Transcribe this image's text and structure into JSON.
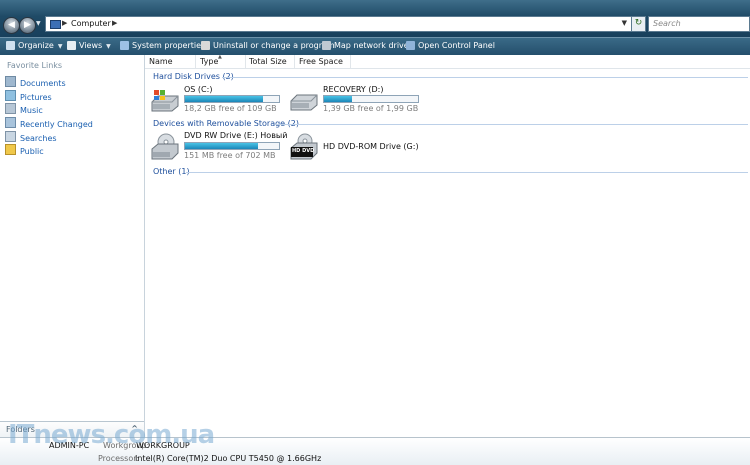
{
  "address_bar": {
    "path": [
      "Computer"
    ],
    "search_placeholder": "Search",
    "back_icon": "back-arrow-icon",
    "forward_icon": "forward-arrow-icon",
    "refresh_icon": "refresh-icon"
  },
  "toolbar": {
    "items": [
      {
        "label": "Organize",
        "icon": "organize-icon",
        "dropdown": true
      },
      {
        "label": "Views",
        "icon": "views-icon",
        "dropdown": true
      },
      {
        "label": "System properties",
        "icon": "system-properties-icon"
      },
      {
        "label": "Uninstall or change a program",
        "icon": "uninstall-icon"
      },
      {
        "label": "Map network drive",
        "icon": "network-drive-icon"
      },
      {
        "label": "Open Control Panel",
        "icon": "control-panel-icon"
      }
    ]
  },
  "nav_pane": {
    "title": "Favorite Links",
    "items": [
      {
        "label": "Documents",
        "icon": "documents-icon"
      },
      {
        "label": "Pictures",
        "icon": "pictures-icon"
      },
      {
        "label": "Music",
        "icon": "music-icon"
      },
      {
        "label": "Recently Changed",
        "icon": "recently-changed-icon"
      },
      {
        "label": "Searches",
        "icon": "searches-icon"
      },
      {
        "label": "Public",
        "icon": "public-folder-icon"
      }
    ],
    "folders_label": "Folders",
    "folders_toggle": "^"
  },
  "columns": [
    "Name",
    "Type",
    "Total Size",
    "Free Space"
  ],
  "groups": {
    "hdd": {
      "title": "Hard Disk Drives (2)",
      "drives": [
        {
          "name": "OS (C:)",
          "free": "18,2 GB free of 109 GB",
          "used_fraction": 0.83,
          "icon": "hard-drive-os-icon"
        },
        {
          "name": "RECOVERY (D:)",
          "free": "1,39 GB free of 1,99 GB",
          "used_fraction": 0.3,
          "icon": "hard-drive-icon"
        }
      ]
    },
    "removable": {
      "title": "Devices with Removable Storage (2)",
      "drives": [
        {
          "name": "DVD RW Drive (E:) Новый",
          "free": "151 MB free of 702 MB",
          "used_fraction": 0.78,
          "icon": "dvd-rw-drive-icon"
        },
        {
          "name": "HD DVD-ROM Drive (G:)",
          "badge": "HD DVD",
          "icon": "hd-dvd-drive-icon"
        }
      ]
    },
    "other": {
      "title": "Other (1)"
    }
  },
  "details": {
    "computer_name": "ADMIN-PC",
    "workgroup_label": "Workgroup:",
    "workgroup": "WORKGROUP",
    "processor_label": "Processor:",
    "processor": "Intel(R) Core(TM)2 Duo CPU     T5450  @ 1.66GHz"
  },
  "watermark": "ITnews.com.ua"
}
